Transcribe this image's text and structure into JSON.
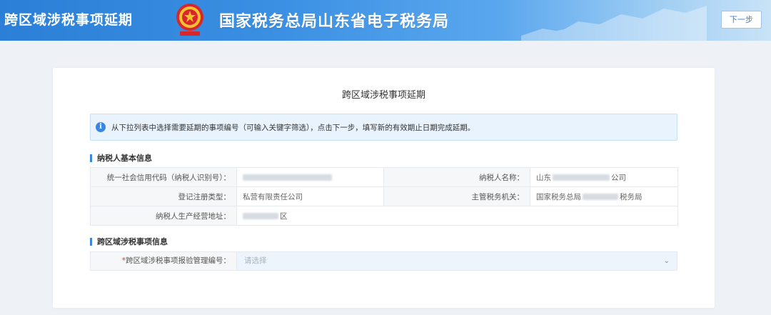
{
  "header": {
    "app_title": "跨区域涉税事项延期",
    "org_name": "国家税务总局山东省电子税务局",
    "next_label": "下一步"
  },
  "card": {
    "title": "跨区域涉税事项延期",
    "notice": "从下拉列表中选择需要延期的事项编号（可输入关键字筛选），点击下一步，填写新的有效期止日期完成延期。",
    "taxpayer_section": "纳税人基本信息",
    "fields": {
      "credit_code_label": "统一社会信用代码（纳税人识别号）：",
      "taxpayer_name_label": "纳税人名称：",
      "taxpayer_name_value_prefix": "山东",
      "taxpayer_name_value_suffix": "公司",
      "reg_type_label": "登记注册类型：",
      "reg_type_value": "私营有限责任公司",
      "tax_authority_label": "主管税务机关：",
      "tax_authority_value_prefix": "国家税务总局",
      "tax_authority_value_suffix": "税务局",
      "address_label": "纳税人生产经营地址：",
      "address_value_suffix": "区"
    },
    "cross_section": "跨区域涉税事项信息",
    "select_label_req": "*",
    "select_label": "跨区域涉税事项报验管理编号：",
    "select_placeholder": "请选择"
  },
  "colors": {
    "accent": "#3a86e0",
    "notice_bg": "#e8f3fd",
    "required": "#e33333"
  }
}
